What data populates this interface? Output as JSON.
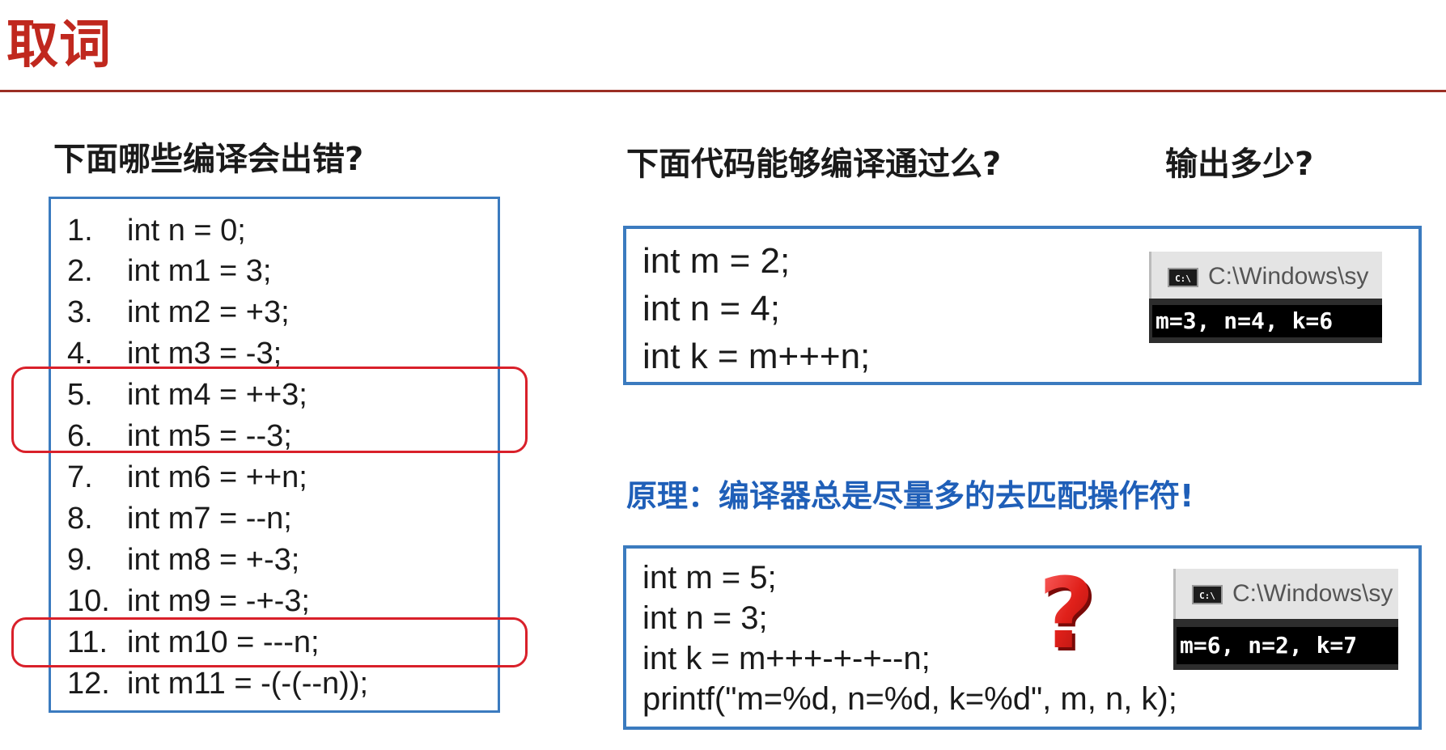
{
  "title": "取词",
  "left": {
    "question": "下面哪些编译会出错?",
    "items": [
      {
        "num": "1.",
        "code": "int n = 0;"
      },
      {
        "num": "2.",
        "code": "int m1 = 3;"
      },
      {
        "num": "3.",
        "code": "int m2 = +3;"
      },
      {
        "num": "4.",
        "code": "int m3 = -3;"
      },
      {
        "num": "5.",
        "code": "int m4 = ++3;"
      },
      {
        "num": "6.",
        "code": "int m5 = --3;"
      },
      {
        "num": "7.",
        "code": "int m6 = ++n;"
      },
      {
        "num": "8.",
        "code": "int m7 = --n;"
      },
      {
        "num": "9.",
        "code": "int m8 = +-3;"
      },
      {
        "num": "10.",
        "code": "int m9 = -+-3;"
      },
      {
        "num": "11.",
        "code": "int m10 = ---n;"
      },
      {
        "num": "12.",
        "code": "int m11 = -(-(--n));"
      }
    ]
  },
  "right": {
    "question1": "下面代码能够编译通过么?",
    "question2": "输出多少?",
    "code1": [
      "int m = 2;",
      "int n = 4;",
      "int k = m+++n;"
    ],
    "console1": {
      "title": "C:\\Windows\\sy",
      "output": "m=3, n=4, k=6",
      "icon": "console-icon"
    },
    "principle": "原理：编译器总是尽量多的去匹配操作符!",
    "code2": [
      "int m = 5;",
      "int n = 3;",
      "int k = m+++-+-+--n;",
      "printf(\"m=%d, n=%d, k=%d\", m, n, k);"
    ],
    "console2": {
      "title": "C:\\Windows\\sy",
      "output": "m=6, n=2, k=7",
      "icon": "console-icon"
    },
    "question_mark": "?"
  },
  "colors": {
    "title": "#c0281e",
    "box_border": "#3b7bbf",
    "highlight": "#d9202a",
    "principle": "#1f5fb8"
  }
}
